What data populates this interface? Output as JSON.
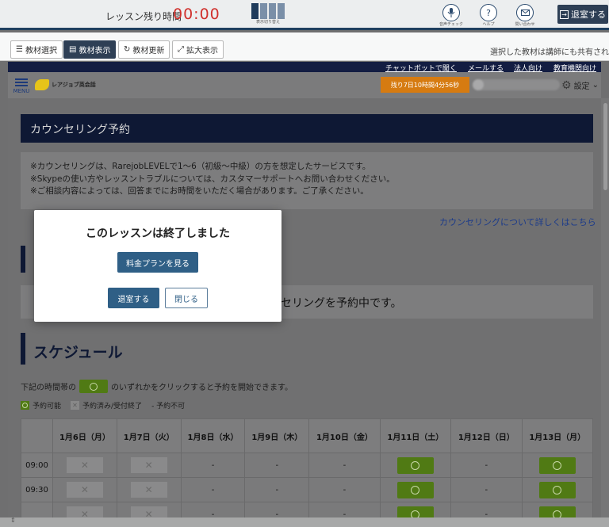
{
  "lesson_bar": {
    "remain_label": "レッスン残り時間",
    "remain_time": "00:00",
    "layout_label": "表示切り替え",
    "tools": [
      {
        "icon": "microphone-icon",
        "label": "音声チェック"
      },
      {
        "icon": "help-icon",
        "label": "ヘルプ"
      },
      {
        "icon": "mail-icon",
        "label": "問い合わせ"
      }
    ],
    "exit_label": "退室する"
  },
  "material_bar": {
    "buttons": [
      {
        "icon": "list-icon",
        "label": "教材選択",
        "active": false
      },
      {
        "icon": "book-icon",
        "label": "教材表示",
        "active": true
      },
      {
        "icon": "refresh-icon",
        "label": "教材更新",
        "active": false
      },
      {
        "icon": "expand-icon",
        "label": "拡大表示",
        "active": false
      }
    ],
    "share_note": "選択した教材は講師にも共有されま"
  },
  "site_header": {
    "nav_links": [
      "チャットボットで聞く",
      "メールする",
      "法人向け",
      "教育機関向け"
    ],
    "menu_label": "MENU",
    "logo_text": "レアジョブ英会話",
    "countdown": "残り7日10時間4分56秒",
    "settings_label": "設定"
  },
  "page": {
    "title": "カウンセリング予約",
    "notice_lines": [
      "※カウンセリングは、RarejobLEVELで1〜6（初級〜中級）の方を想定したサービスです。",
      "※Skypeの使い方やレッスントラブルについては、カスタマーサポートへお問い合わせください。",
      "※ご相談内容によっては、回答までにお時間をいただく場合があります。ご了承ください。"
    ],
    "counsel_link": "カウンセリングについて詳しくはこちら",
    "booking_status": "セリングを予約中です。",
    "schedule_title": "スケジュール",
    "hint_before": "下記の時間帯の",
    "hint_after": "のいずれかをクリックすると予約を開始できます。",
    "legend": {
      "available": "予約可能",
      "booked": "予約済み/受付終了",
      "unavailable": "- 予約不可"
    }
  },
  "schedule": {
    "days": [
      "1月6日（月）",
      "1月7日（火）",
      "1月8日（水）",
      "1月9日（木）",
      "1月10日（金）",
      "1月11日（土）",
      "1月12日（日）",
      "1月13日（月）"
    ],
    "rows": [
      {
        "time": "09:00",
        "cells": [
          "x",
          "x",
          "-",
          "-",
          "-",
          "o",
          "-",
          "o"
        ]
      },
      {
        "time": "09:30",
        "cells": [
          "x",
          "x",
          "-",
          "-",
          "-",
          "o",
          "-",
          "o"
        ]
      },
      {
        "time": "",
        "cells": [
          "x",
          "x",
          "-",
          "-",
          "-",
          "o",
          "-",
          "o"
        ]
      }
    ]
  },
  "modal": {
    "title": "このレッスンは終了しました",
    "plan_button": "料金プランを見る",
    "exit_button": "退室する",
    "close_button": "閉じる"
  }
}
